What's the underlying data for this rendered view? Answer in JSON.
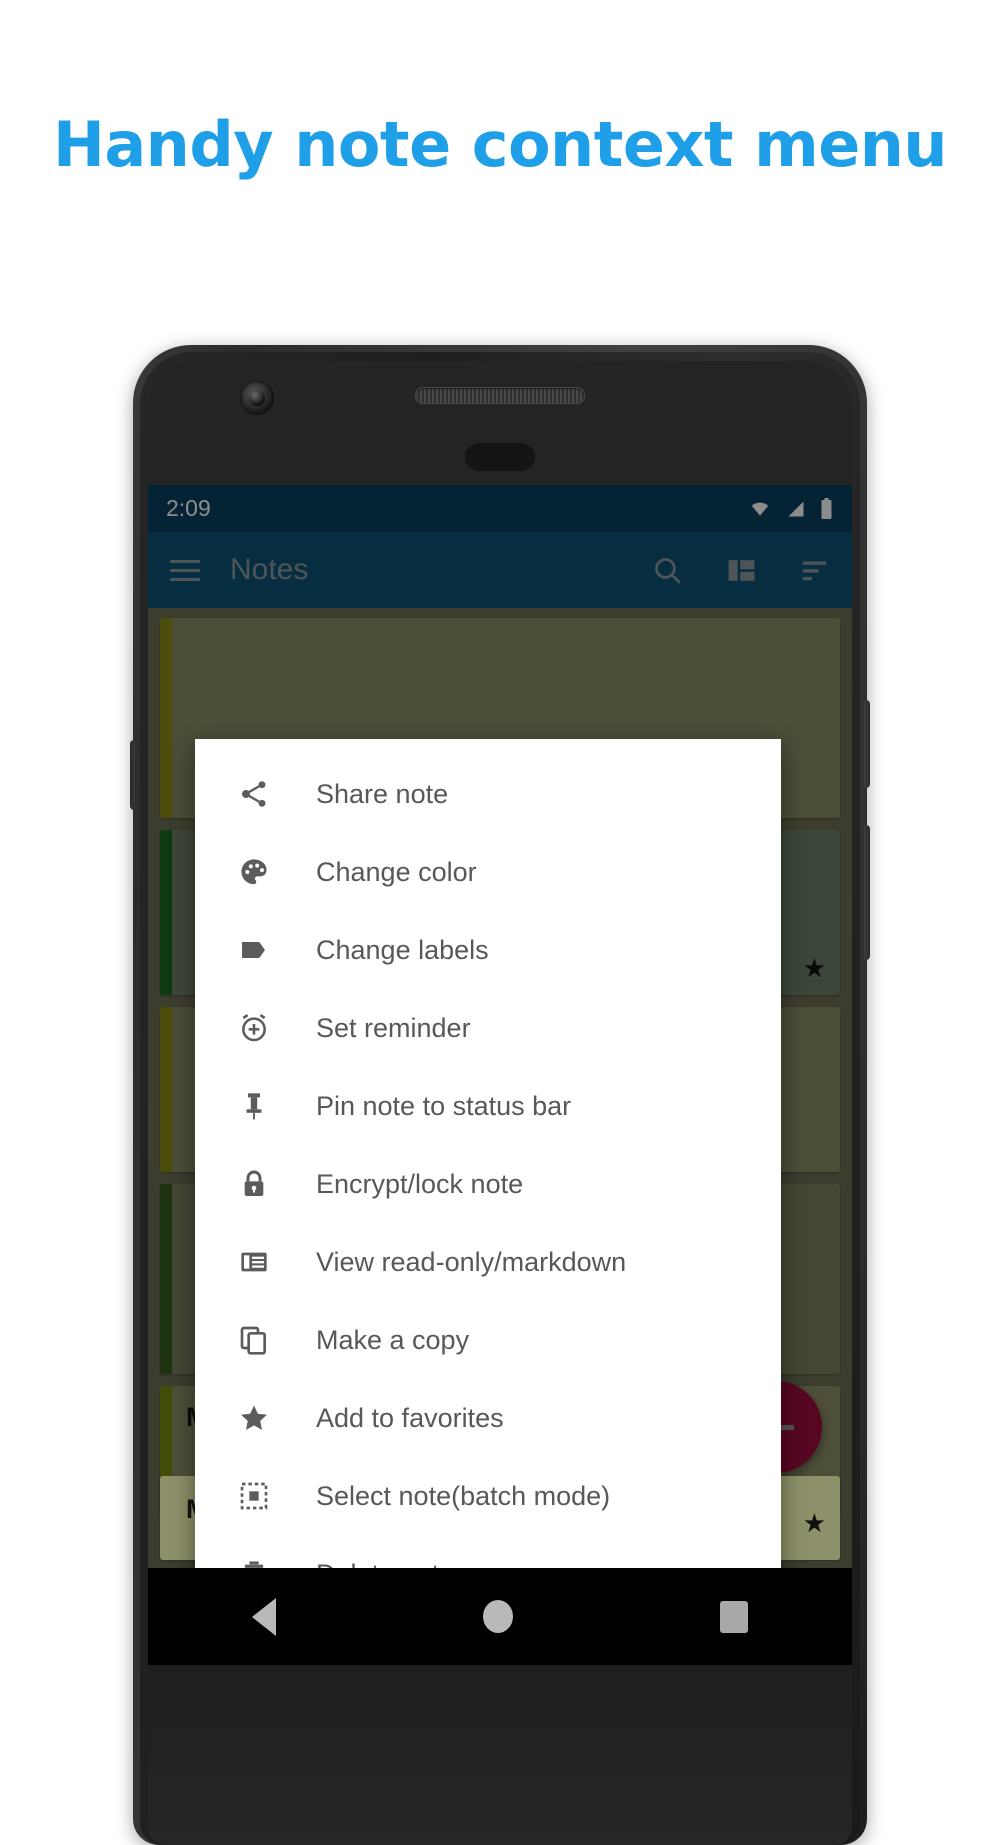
{
  "headline": "Handy note context menu",
  "colors": {
    "headline": "#1E9FE8",
    "statusbar": "#084160",
    "toolbar": "#0d5476",
    "fab": "#9e0e3c",
    "menu_text": "#585858"
  },
  "phone": {
    "status_bar": {
      "clock": "2:09",
      "icons": [
        "wifi-icon",
        "signal-icon",
        "battery-icon"
      ]
    },
    "toolbar": {
      "menu_icon": "hamburger-menu-icon",
      "title": "Notes",
      "actions": [
        {
          "name": "search-icon",
          "label": "Search"
        },
        {
          "name": "layout-grid-icon",
          "label": "Change layout"
        },
        {
          "name": "sort-icon",
          "label": "Sort"
        }
      ]
    },
    "notes": [
      {
        "title": "",
        "body": "",
        "stripe": "#8a8a14",
        "bg": "#8d8f66",
        "starred": false
      },
      {
        "title": "",
        "body": "",
        "stripe": "#1d6b22",
        "bg": "#6f8169",
        "starred": true
      },
      {
        "title": "",
        "body": "",
        "stripe": "#8a8a14",
        "bg": "#8d8f66",
        "starred": false
      },
      {
        "title": "",
        "body": "",
        "stripe": "#3a5d1f",
        "bg": "#7b8460",
        "starred": false
      },
      {
        "title": "My supersecret journal",
        "body": "",
        "stripe": "#7d8a12",
        "bg": "#8d9068",
        "starred": true
      }
    ],
    "fab": {
      "name": "add-note-fab",
      "glyph": "+"
    },
    "context_menu": [
      {
        "icon": "share-icon",
        "label": "Share note"
      },
      {
        "icon": "palette-icon",
        "label": "Change color"
      },
      {
        "icon": "label-tag-icon",
        "label": "Change labels"
      },
      {
        "icon": "alarm-add-icon",
        "label": "Set reminder"
      },
      {
        "icon": "pushpin-icon",
        "label": "Pin note to status bar"
      },
      {
        "icon": "lock-icon",
        "label": "Encrypt/lock note"
      },
      {
        "icon": "read-only-markdown-icon",
        "label": "View read-only/markdown"
      },
      {
        "icon": "copy-icon",
        "label": "Make a copy"
      },
      {
        "icon": "star-icon",
        "label": "Add to favorites"
      },
      {
        "icon": "select-batch-icon",
        "label": "Select note(batch mode)"
      },
      {
        "icon": "trash-icon",
        "label": "Delete note"
      }
    ],
    "nav_bar": [
      {
        "icon": "back-triangle-icon",
        "label": "Back"
      },
      {
        "icon": "home-circle-icon",
        "label": "Home"
      },
      {
        "icon": "recents-square-icon",
        "label": "Recents"
      }
    ]
  }
}
